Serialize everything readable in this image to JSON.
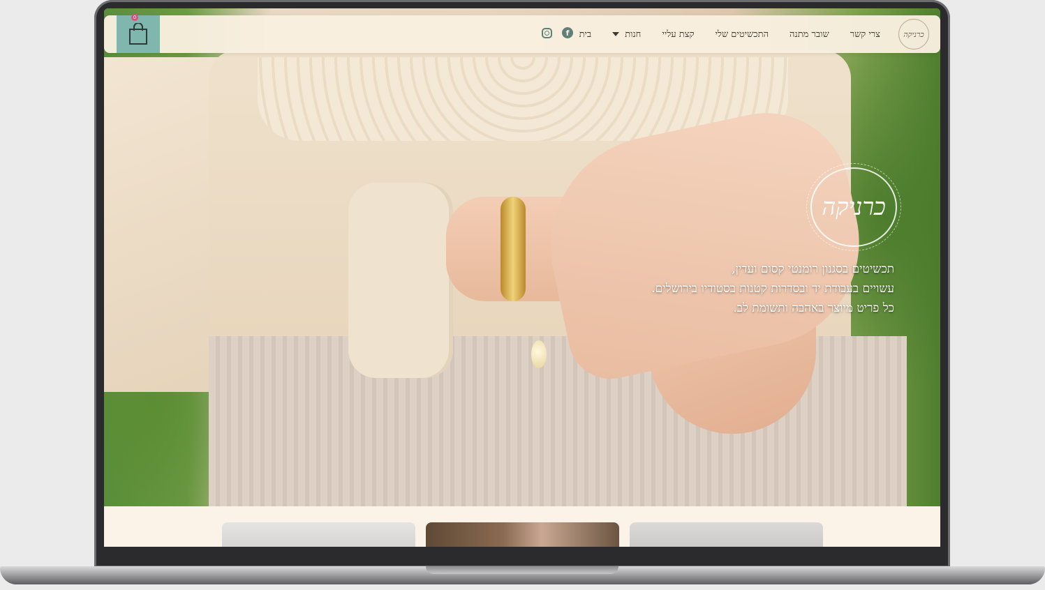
{
  "header": {
    "logo_text": "כרניקה",
    "nav": [
      {
        "label": "בית"
      },
      {
        "label": "חנות",
        "has_dropdown": true
      },
      {
        "label": "קצת עליי"
      },
      {
        "label": "התכשיטים שלי"
      },
      {
        "label": "שובר מתנה"
      },
      {
        "label": "צרי קשר"
      }
    ],
    "social_icons": [
      "facebook-icon",
      "instagram-icon"
    ],
    "cart": {
      "icon": "shopping-bag-icon",
      "count": "0",
      "color": "#7fb6ad"
    }
  },
  "hero": {
    "logo_text": "כרניקה",
    "lines": [
      "תכשיטים בסגנון רומנטי קסום ועדין,",
      "עשויים בעבודת יד ובסדרות קטנות בסטודיו בירושלים.",
      "כל פריט מיוצר באהבה ותשומת לב."
    ]
  },
  "colors": {
    "header_bg": "#f9efe0",
    "accent": "#7fb6ad",
    "badge": "#e04f7a",
    "text": "#3d3a33"
  }
}
